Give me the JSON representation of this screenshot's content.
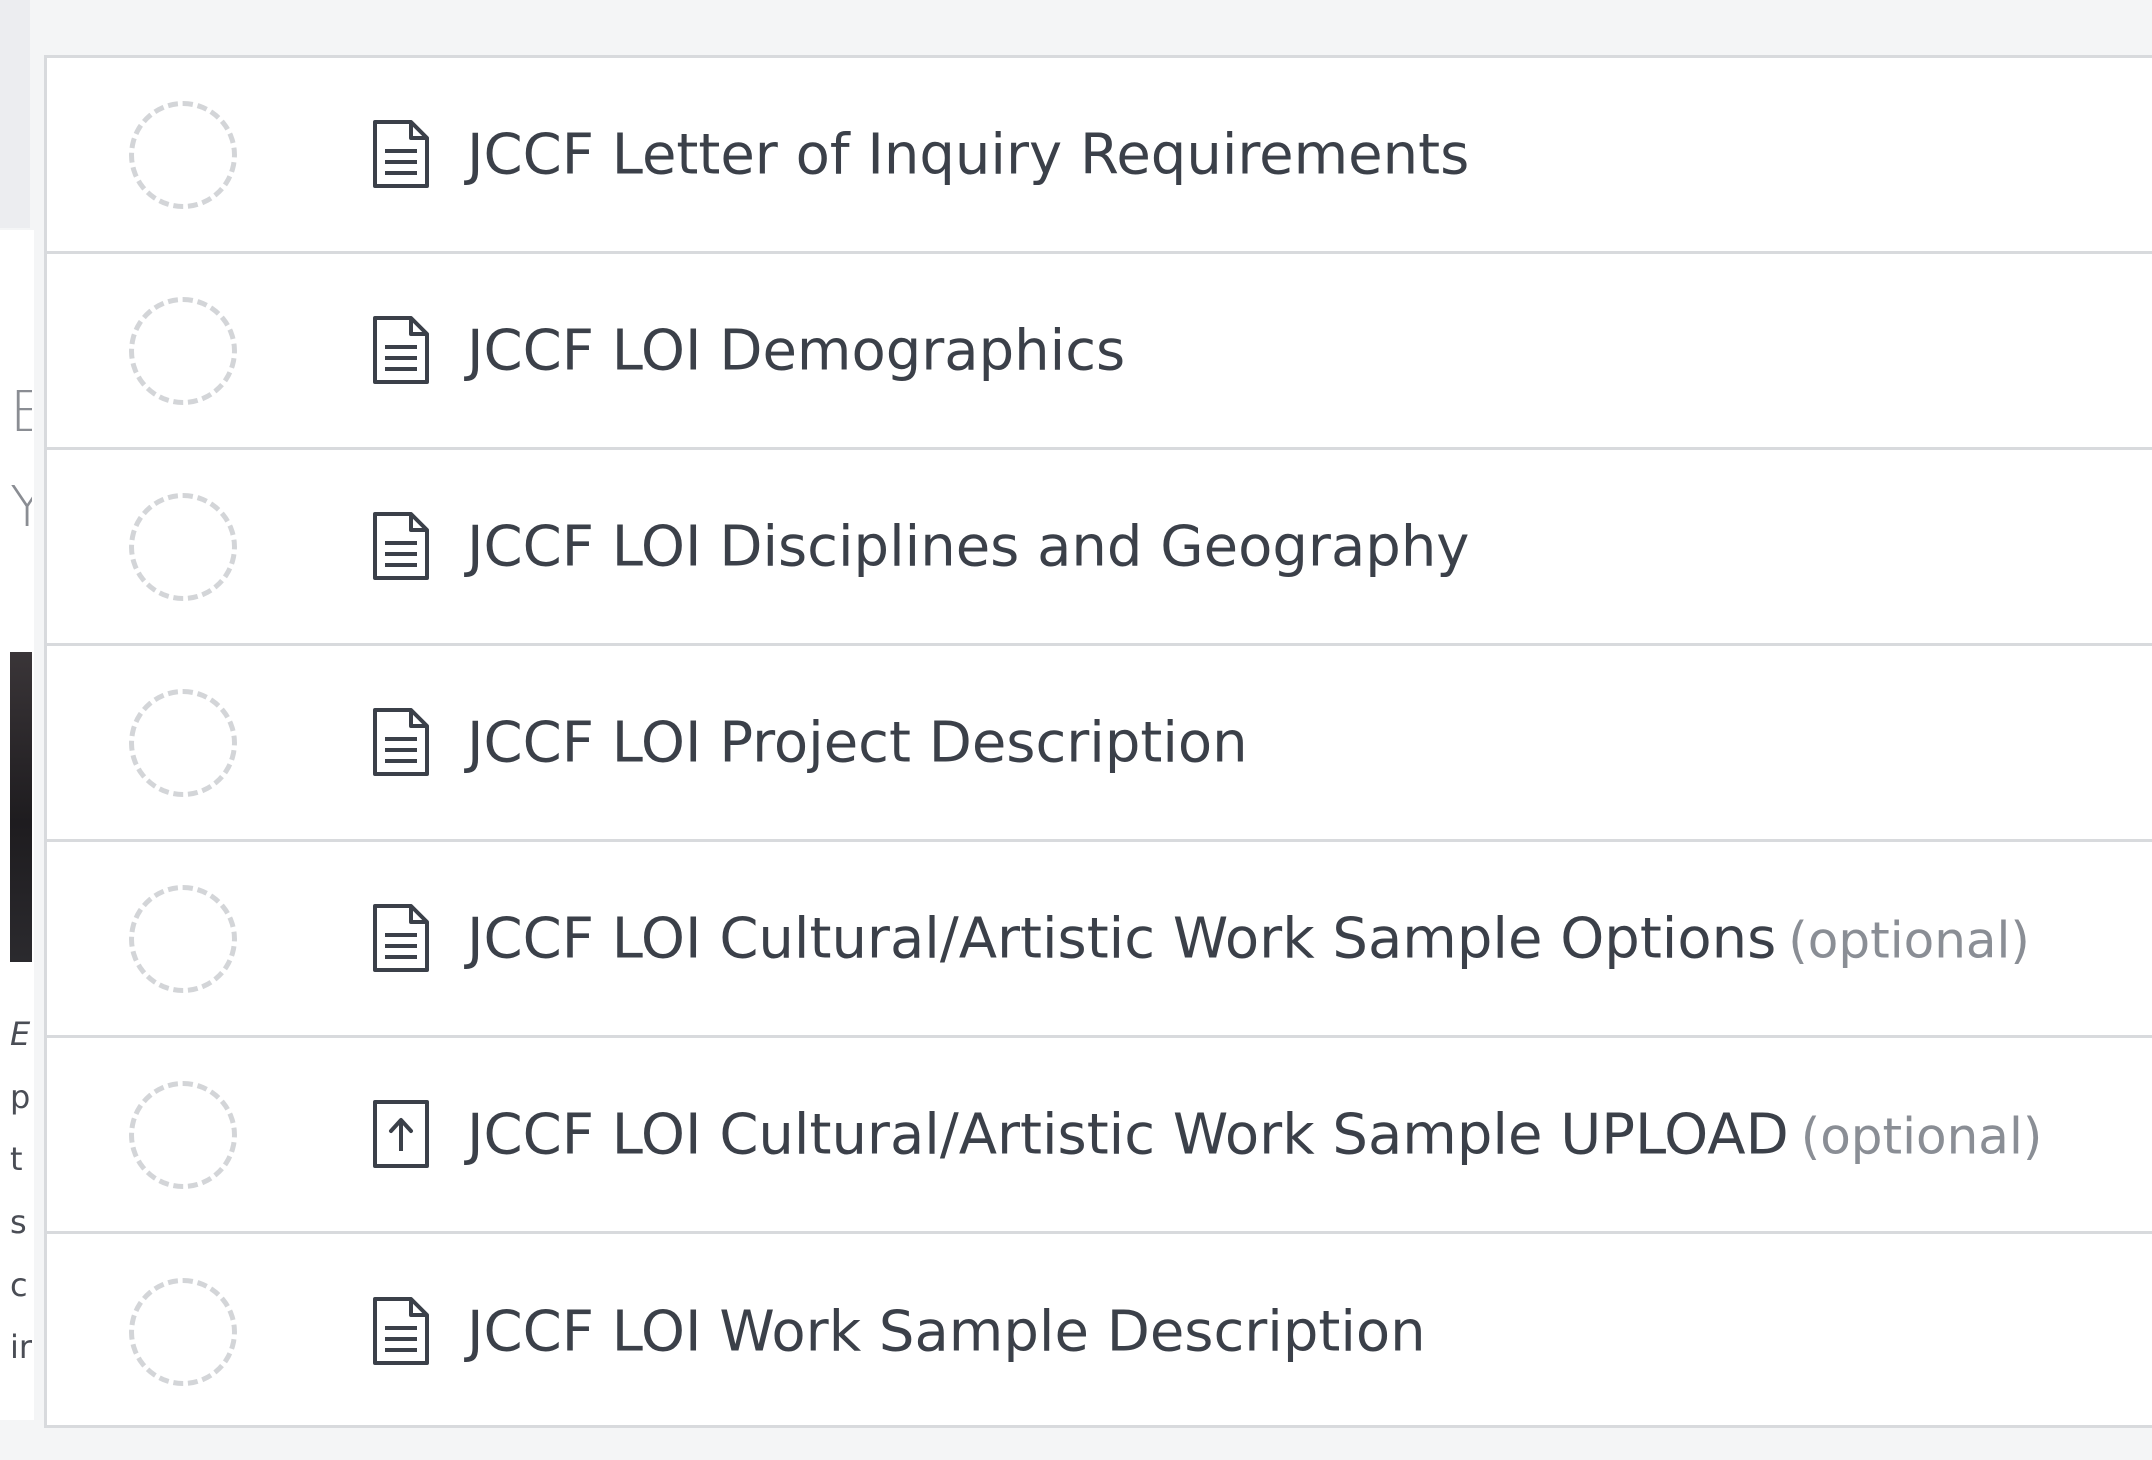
{
  "tasks": [
    {
      "label": "JCCF Letter of Inquiry Requirements",
      "icon": "document-icon",
      "optional": "",
      "status": "incomplete"
    },
    {
      "label": "JCCF LOI Demographics",
      "icon": "document-icon",
      "optional": "",
      "status": "incomplete"
    },
    {
      "label": "JCCF LOI Disciplines and Geography",
      "icon": "document-icon",
      "optional": "",
      "status": "incomplete"
    },
    {
      "label": "JCCF LOI Project Description",
      "icon": "document-icon",
      "optional": "",
      "status": "incomplete"
    },
    {
      "label": "JCCF LOI Cultural/Artistic Work Sample Options",
      "icon": "document-icon",
      "optional": "(optional)",
      "status": "incomplete"
    },
    {
      "label": "JCCF LOI Cultural/Artistic Work Sample UPLOAD",
      "icon": "upload-icon",
      "optional": "(optional)",
      "status": "incomplete"
    },
    {
      "label": "JCCF LOI Work Sample Description",
      "icon": "document-icon",
      "optional": "",
      "status": "incomplete"
    }
  ],
  "background_fragments": {
    "heading_line1": "E",
    "heading_line2": "Y",
    "para_line1": "E",
    "para_line2": "p",
    "para_line3": "t",
    "para_line4": "s",
    "para_line5": "c",
    "para_line6": "ir"
  },
  "colors": {
    "text": "#3b4049",
    "muted": "#8a8e95",
    "border": "#d8dadd",
    "ring": "#d3d5d8"
  }
}
